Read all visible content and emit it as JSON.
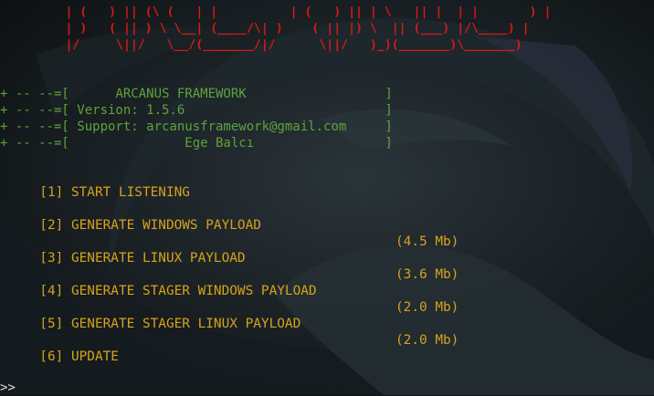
{
  "banner": [
    "         | (   ) || (\\ (   | |          | (   ) || | \\   || |  | |       ) |",
    "         | )   ( || ) \\ \\__| (____/\\| )    ( || |) \\  || (___) |/\\____) |",
    "         |/     \\||/   \\__/(_______/|/      \\||/   )_)(_______)\\_______)"
  ],
  "info": [
    "+ -- --=[      ARCANUS FRAMEWORK                  ]",
    "+ -- --=[ Version: 1.5.6                          ]",
    "+ -- --=[ Support: arcanusframework@gmail.com     ]",
    "+ -- --=[               Ege Balcı                 ]"
  ],
  "menu": [
    {
      "label": " [1] START LISTENING",
      "size": ""
    },
    {
      "label": " [2] GENERATE WINDOWS PAYLOAD",
      "size": "(4.5 Mb)"
    },
    {
      "label": " [3] GENERATE LINUX PAYLOAD",
      "size": "(3.6 Mb)"
    },
    {
      "label": " [4] GENERATE STAGER WINDOWS PAYLOAD",
      "size": "(2.0 Mb)"
    },
    {
      "label": " [5] GENERATE STAGER LINUX PAYLOAD",
      "size": "(2.0 Mb)"
    },
    {
      "label": " [6] UPDATE",
      "size": ""
    }
  ],
  "prompt": ">>",
  "colors": {
    "background": "#0f1416",
    "banner": "#d81919",
    "info": "#5fa33a",
    "menu": "#d6a31a",
    "prompt": "#dcdcdc"
  }
}
